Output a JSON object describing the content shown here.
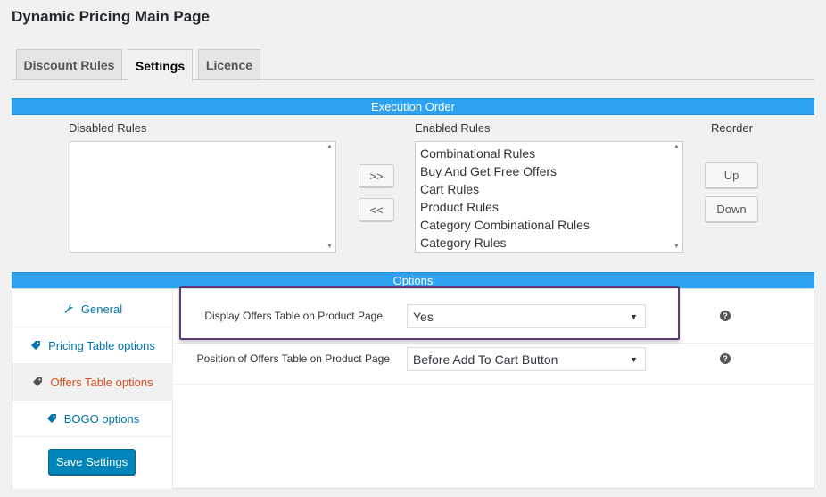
{
  "page_title": "Dynamic Pricing Main Page",
  "tabs": [
    {
      "label": "Discount Rules"
    },
    {
      "label": "Settings"
    },
    {
      "label": "Licence"
    }
  ],
  "execution_order": {
    "header": "Execution Order",
    "disabled_label": "Disabled Rules",
    "enabled_label": "Enabled Rules",
    "reorder_label": "Reorder",
    "move_right": ">>",
    "move_left": "<<",
    "up": "Up",
    "down": "Down",
    "enabled_rules": [
      "Combinational Rules",
      "Buy And Get Free Offers",
      "Cart Rules",
      "Product Rules",
      "Category Combinational Rules",
      "Category Rules"
    ]
  },
  "options": {
    "header": "Options",
    "sidebar": [
      {
        "label": "General",
        "icon": "wrench-icon"
      },
      {
        "label": "Pricing Table options",
        "icon": "tag-icon"
      },
      {
        "label": "Offers Table options",
        "icon": "tag-icon"
      },
      {
        "label": "BOGO options",
        "icon": "tag-icon"
      }
    ],
    "save_label": "Save Settings",
    "fields": [
      {
        "label": "Display Offers Table on Product Page",
        "value": "Yes"
      },
      {
        "label": "Position of Offers Table on Product Page",
        "value": "Before Add To Cart Button"
      }
    ],
    "help_glyph": "?"
  },
  "colors": {
    "accent_blue": "#2ea2f0",
    "primary_button": "#0085ba",
    "active_sidebar_text": "#d54e21",
    "highlight_border": "#5b3a76"
  }
}
